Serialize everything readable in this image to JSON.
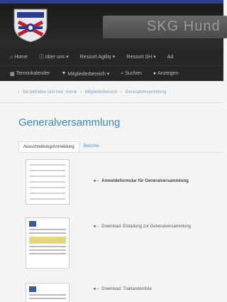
{
  "header": {
    "banner_text": "SKG Hund"
  },
  "nav_primary": [
    {
      "icon": "home-icon",
      "glyph": "⌂",
      "label": "Home"
    },
    {
      "icon": "info-icon",
      "glyph": "ⓘ",
      "label": "über uns ▾"
    },
    {
      "icon": "",
      "glyph": "",
      "label": "Ressort Agility ▾"
    },
    {
      "icon": "",
      "glyph": "",
      "label": "Ressort SH ▾"
    },
    {
      "icon": "",
      "glyph": "",
      "label": "Ad"
    }
  ],
  "nav_secondary": [
    {
      "icon": "calendar-icon",
      "glyph": "▦",
      "label": "Terminkalender"
    },
    {
      "icon": "filter-icon",
      "glyph": "▼",
      "label": "Mitgliederbereich ▾"
    },
    {
      "icon": "search-icon",
      "glyph": "⌕",
      "label": "Suchen"
    },
    {
      "icon": "flag-icon",
      "glyph": "●",
      "label": "Anzeigen"
    }
  ],
  "breadcrumb": {
    "prefix": "Sie befinden sich hier:",
    "items": [
      "Home",
      "Mitgliederbereich",
      "Generalversammlung"
    ]
  },
  "page": {
    "title": "Generalversammlung"
  },
  "tabs": [
    {
      "label": "Ausschreibung/Anmeldung",
      "active": true
    },
    {
      "label": "Berichte",
      "active": false
    }
  ],
  "documents": [
    {
      "label": "Anmeldeformular für Generalversammlung",
      "bold": true
    },
    {
      "label": "Download: Einladung zur Generalversammlung",
      "bold": false
    },
    {
      "label": "Download: Traktandenliste",
      "bold": false
    }
  ]
}
